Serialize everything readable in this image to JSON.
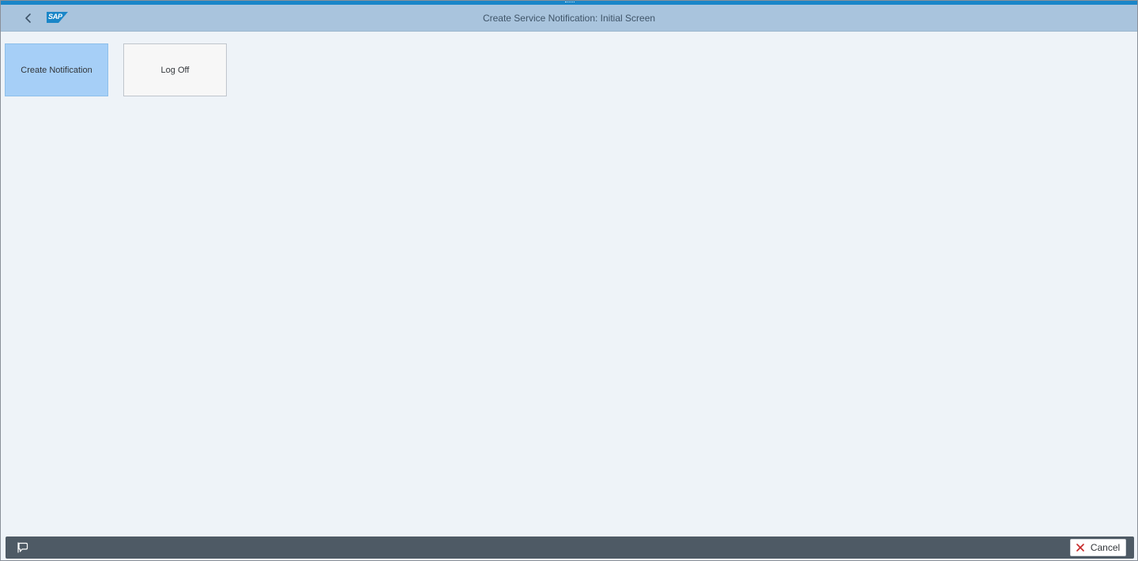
{
  "header": {
    "title": "Create Service Notification: Initial Screen",
    "logo_text": "SAP",
    "back_icon": "chevron-left-icon",
    "logo_color": "#1a86c8"
  },
  "tiles": [
    {
      "label": "Create Notification",
      "state": "selected",
      "color": "#a6cff7"
    },
    {
      "label": "Log Off",
      "state": "default",
      "color": "#f7f7f7"
    }
  ],
  "footer": {
    "message_icon": "message-popover-icon",
    "cancel_label": "Cancel",
    "cancel_icon": "close-icon",
    "cancel_icon_color": "#c62828"
  },
  "colors": {
    "brand_blue": "#1a86c8",
    "header_bg": "#a9c4dd",
    "content_bg": "#eef3f8",
    "footer_bg": "#4e5a65"
  }
}
